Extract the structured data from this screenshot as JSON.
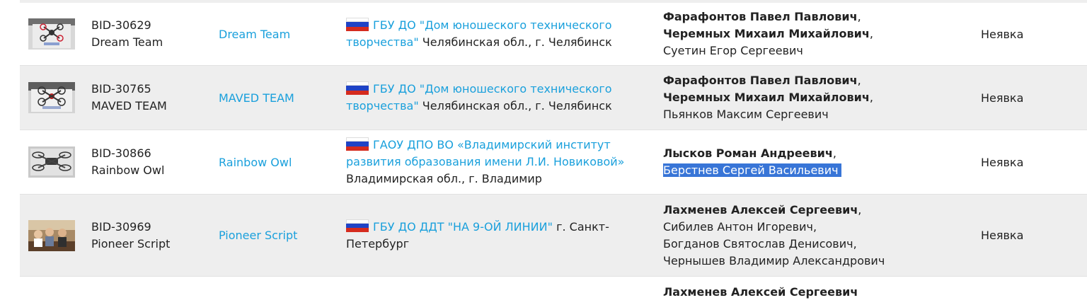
{
  "rows": [
    {
      "bid": "BID-30629",
      "team_name": "Dream Team",
      "team_link": "Dream Team",
      "photo_icon": "drone-photo",
      "org_link": "ГБУ ДО \"Дом юношеского технического творчества\"",
      "org_location": "Челябинская обл., г. Челябинск",
      "mentors_bold": [
        "Фарафонтов Павел Павлович",
        "Черемных Михаил Михайлович"
      ],
      "members": [
        "Суетин Егор Сергеевич"
      ],
      "status": "Неявка"
    },
    {
      "bid": "BID-30765",
      "team_name": "MAVED TEAM",
      "team_link": "MAVED TEAM",
      "photo_icon": "drone-photo",
      "org_link": "ГБУ ДО \"Дом юношеского технического творчества\"",
      "org_location": "Челябинская обл., г. Челябинск",
      "mentors_bold": [
        "Фарафонтов Павел Павлович",
        "Черемных Михаил Михайлович"
      ],
      "members": [
        "Пьянков Максим Сергеевич"
      ],
      "status": "Неявка"
    },
    {
      "bid": "BID-30866",
      "team_name": "Rainbow Owl",
      "team_link": "Rainbow Owl",
      "photo_icon": "drone-photo",
      "org_link": "ГАОУ ДПО ВО «Владимирский институт развития образования имени Л.И. Новиковой»",
      "org_location": "Владимирская обл., г. Владимир",
      "mentors_bold": [
        "Лысков Роман Андреевич"
      ],
      "members": [
        "Берстнев Сергей Васильевич"
      ],
      "status": "Неявка"
    },
    {
      "bid": "BID-30969",
      "team_name": "Pioneer Script",
      "team_link": "Pioneer Script",
      "photo_icon": "team-photo",
      "org_link": "ГБУ ДО ДДТ \"НА 9-ОЙ ЛИНИИ\"",
      "org_location": "г. Санкт-Петербург",
      "mentors_bold": [
        "Лахменев Алексей Сергеевич"
      ],
      "members": [
        "Сибилев Антон Игоревич",
        "Богданов Святослав Денисович",
        "Чернышев Владимир Александрович"
      ],
      "status": "Неявка"
    }
  ],
  "partial_row": {
    "mentor_bold": "Лахменев Алексей Сергеевич"
  }
}
